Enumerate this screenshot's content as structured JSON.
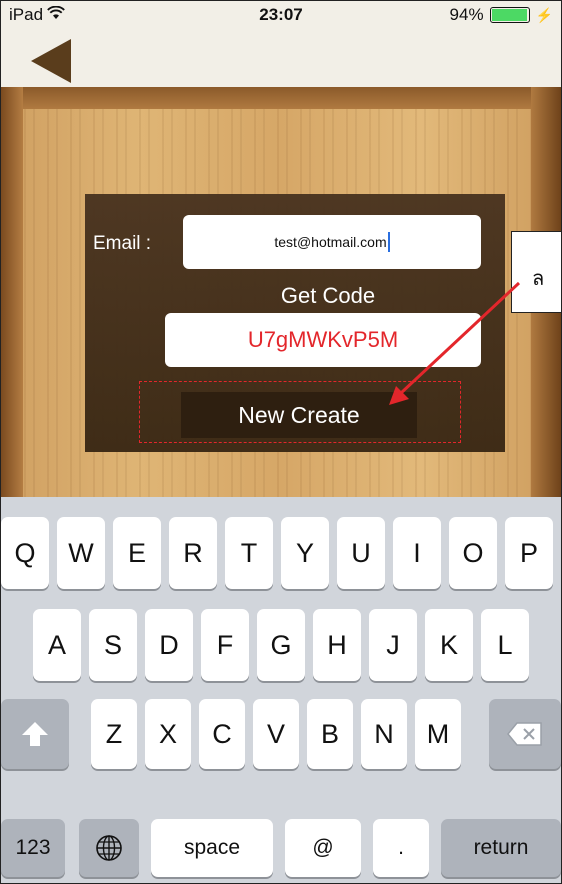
{
  "status": {
    "device": "iPad",
    "time": "23:07",
    "battery_text": "94%",
    "battery_level": 0.94,
    "battery_color": "#4cd964"
  },
  "nav": {
    "back_icon": "back-arrow-icon"
  },
  "form": {
    "email_label": "Email :",
    "email_value": "test@hotmail.com",
    "get_code_label": "Get Code",
    "code_value": "U7gMWKvP5M",
    "new_create_label": "New Create"
  },
  "annotation": {
    "callout_text": "ล",
    "arrow_color": "#e3262b"
  },
  "keyboard": {
    "row1": [
      "Q",
      "W",
      "E",
      "R",
      "T",
      "Y",
      "U",
      "I",
      "O",
      "P"
    ],
    "row2": [
      "A",
      "S",
      "D",
      "F",
      "G",
      "H",
      "J",
      "K",
      "L"
    ],
    "row3": [
      "Z",
      "X",
      "C",
      "V",
      "B",
      "N",
      "M"
    ],
    "bottom": {
      "numbers": "123",
      "space": "space",
      "at": "@",
      "dot": ".",
      "return": "return"
    }
  },
  "colors": {
    "accent_red": "#e3262b",
    "panel_brown": "#3a2814",
    "wood": "#d6a767"
  }
}
